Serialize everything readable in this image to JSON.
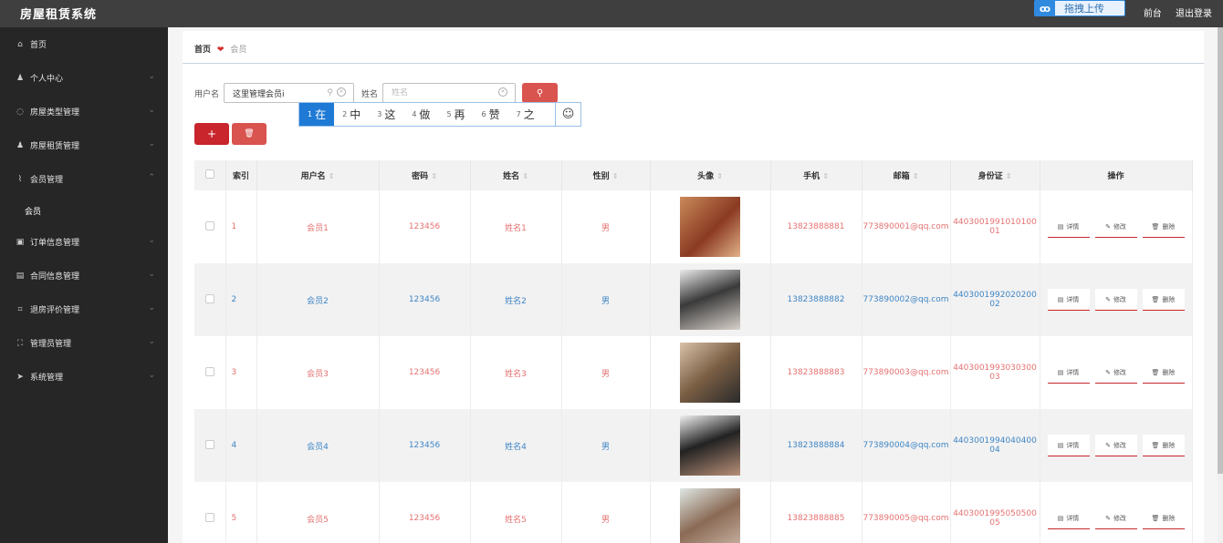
{
  "header": {
    "brand": "房屋租赁系统",
    "upload_label": "拖拽上传",
    "upload_icon": "cloud-icon",
    "front_link": "前台",
    "logout_link": "退出登录"
  },
  "sidebar": {
    "items": [
      {
        "label": "首页",
        "icon": "home-icon",
        "chevron": false
      },
      {
        "label": "个人中心",
        "icon": "user-icon",
        "chevron": true
      },
      {
        "label": "房屋类型管理",
        "icon": "compass-icon",
        "chevron": true
      },
      {
        "label": "房屋租赁管理",
        "icon": "user-icon",
        "chevron": true
      },
      {
        "label": "会员管理",
        "icon": "leaf-icon",
        "chevron": true,
        "expanded": true
      },
      {
        "label": "订单信息管理",
        "icon": "picture-icon",
        "chevron": true
      },
      {
        "label": "合同信息管理",
        "icon": "tag-icon",
        "chevron": true
      },
      {
        "label": "退房评价管理",
        "icon": "crop-icon",
        "chevron": true
      },
      {
        "label": "管理员管理",
        "icon": "frame-icon",
        "chevron": true
      },
      {
        "label": "系统管理",
        "icon": "send-icon",
        "chevron": true
      }
    ],
    "sub_item": "会员"
  },
  "breadcrumb": {
    "home": "首页",
    "current": "会员"
  },
  "search": {
    "username_label": "用户名",
    "username_value": "这里管理会员i",
    "name_label": "姓名",
    "name_placeholder": "姓名"
  },
  "ime": {
    "candidates": [
      {
        "n": "1",
        "t": "在"
      },
      {
        "n": "2",
        "t": "中"
      },
      {
        "n": "3",
        "t": "这"
      },
      {
        "n": "4",
        "t": "做"
      },
      {
        "n": "5",
        "t": "再"
      },
      {
        "n": "6",
        "t": "赞"
      },
      {
        "n": "7",
        "t": "之"
      }
    ],
    "emoji": "☺"
  },
  "actions": {
    "add": "+",
    "delete_icon": "trash-icon"
  },
  "table": {
    "headers": {
      "index": "索引",
      "username": "用户名",
      "password": "密码",
      "name": "姓名",
      "gender": "性别",
      "avatar": "头像",
      "phone": "手机",
      "email": "邮箱",
      "idcard": "身份证",
      "ops": "操作"
    },
    "sort_glyph": "⇕",
    "ops": {
      "detail": "详情",
      "edit": "修改",
      "delete": "删除"
    },
    "rows": [
      {
        "index": "1",
        "username": "会员1",
        "password": "123456",
        "name": "姓名1",
        "gender": "男",
        "phone": "13823888881",
        "email": "773890001@qq.com",
        "idcard": "440300199101010001"
      },
      {
        "index": "2",
        "username": "会员2",
        "password": "123456",
        "name": "姓名2",
        "gender": "男",
        "phone": "13823888882",
        "email": "773890002@qq.com",
        "idcard": "440300199202020002"
      },
      {
        "index": "3",
        "username": "会员3",
        "password": "123456",
        "name": "姓名3",
        "gender": "男",
        "phone": "13823888883",
        "email": "773890003@qq.com",
        "idcard": "440300199303030003"
      },
      {
        "index": "4",
        "username": "会员4",
        "password": "123456",
        "name": "姓名4",
        "gender": "男",
        "phone": "13823888884",
        "email": "773890004@qq.com",
        "idcard": "440300199404040004"
      },
      {
        "index": "5",
        "username": "会员5",
        "password": "123456",
        "name": "姓名5",
        "gender": "男",
        "phone": "13823888885",
        "email": "773890005@qq.com",
        "idcard": "440300199505050005"
      }
    ]
  },
  "colors": {
    "topbar": "#3f3f3f",
    "sidebar": "#262626",
    "accent_red": "#c8252c",
    "value_red": "#e57171",
    "value_blue": "#3f86c6",
    "ime_selected": "#1f7ad6"
  }
}
